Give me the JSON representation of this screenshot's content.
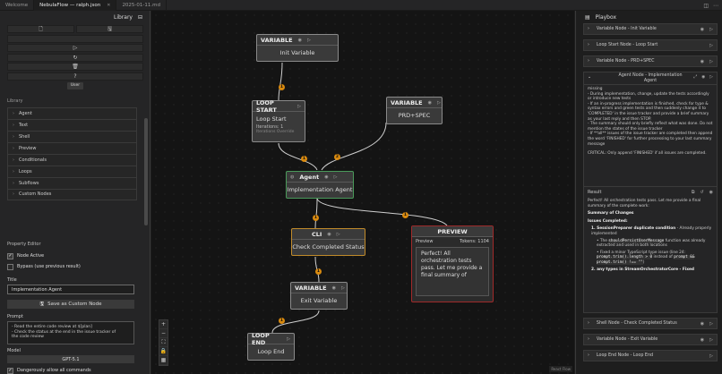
{
  "tabs": [
    {
      "label": "Welcome"
    },
    {
      "label": "NebulaFlow — ralph.json"
    },
    {
      "label": "2025-01-11.md"
    }
  ],
  "library": {
    "title": "Library",
    "user_label": "User",
    "section_label": "Library",
    "items": [
      "Agent",
      "Text",
      "Shell",
      "Preview",
      "Conditionals",
      "Loops",
      "Subflows",
      "Custom Nodes"
    ]
  },
  "property_editor": {
    "title": "Property Editor",
    "node_active_label": "Node Active",
    "node_active": true,
    "bypass_label": "Bypass (use previous result)",
    "bypass": false,
    "title_label": "Title",
    "title_value": "Implementation Agent",
    "save_custom_label": "Save as Custom Node",
    "prompt_label": "Prompt",
    "prompt_lines": [
      "- Read the entire code review at $[plan]",
      "- Check the status at the end in the issue tracker of",
      "the code review"
    ],
    "model_label": "Model",
    "model_value": "GPT-5.1",
    "dangerous_label": "Dangerously allow all commands"
  },
  "nodes": {
    "init": {
      "type": "VARIABLE",
      "body": "Init Variable"
    },
    "loop_start": {
      "type": "LOOP START",
      "body": "Loop Start",
      "iterations": "Iterations: 1",
      "override": "Iterations Override"
    },
    "prd": {
      "type": "VARIABLE",
      "body": "PRD+SPEC"
    },
    "agent": {
      "type": "Agent",
      "body": "Implementation Agent"
    },
    "cli": {
      "type": "CLI",
      "body": "Check Completed Status"
    },
    "preview": {
      "type": "PREVIEW",
      "sub": "Preview",
      "tokens": "Tokens: 1104",
      "body": "Perfect! All orchestration tests pass. Let me provide a final summary of"
    },
    "exit": {
      "type": "VARIABLE",
      "body": "Exit Variable"
    },
    "loop_end": {
      "type": "LOOP END",
      "body": "Loop End"
    }
  },
  "badges": [
    "1",
    "1",
    "2",
    "1",
    "1",
    "1",
    "1"
  ],
  "canvas_attr": "React Flow",
  "playbox": {
    "title": "Playbox",
    "items_top": [
      "Variable Node - Init Variable",
      "Loop Start Node - Loop Start",
      "Variable Node - PRD+SPEC"
    ],
    "open_title": "Agent Node - Implementation Agent",
    "instructions": [
      "missing",
      "- During implementation, change, update the tests accordingly or introduce new tests",
      "- If an in-progress implementation is finished, check for type & syntax errors and green tests and then suddenly change it to 'COMPLETED' in the issue tracker and provide a brief summary as your last reply and then STOP.",
      "- The summary should only briefly reflect what was done. Do not mention the states of the issue tracker",
      "- If **all** issues of the issue tracker are completed then append the word 'FINISHED' for further processing to your last summary message",
      "",
      "CRITICAL: Only append 'FINISHED' if all issues are completed."
    ],
    "result_label": "Result",
    "result_intro": "Perfect! All orchestration tests pass. Let me provide a final summary of the complete work:",
    "summary_heading": "Summary of Changes",
    "issues_heading": "Issues Completed:",
    "issue1_title": "1. SessionPreparer duplicate condition",
    "issue1_tail": " - Already properly implemented",
    "bullet1_a": "The ",
    "bullet1_code": "shouldPersistUserMessage",
    "bullet1_b": " function was already extracted and used in both locations",
    "bullet2_a": "Fixed a minor TypeScript type issue (line 24: ",
    "bullet2_code1": "prompt.trim().length > 0",
    "bullet2_b": " instead of ",
    "bullet2_code2": "prompt && prompt.trim() !== \"\"",
    "bullet2_c": ")",
    "issue2": "2. any types in StreamOrchestratorCore - Fixed",
    "items_bottom": [
      "Shell Node - Check Completed Status",
      "Variable Node - Exit Variable",
      "Loop End Node - Loop End"
    ]
  }
}
